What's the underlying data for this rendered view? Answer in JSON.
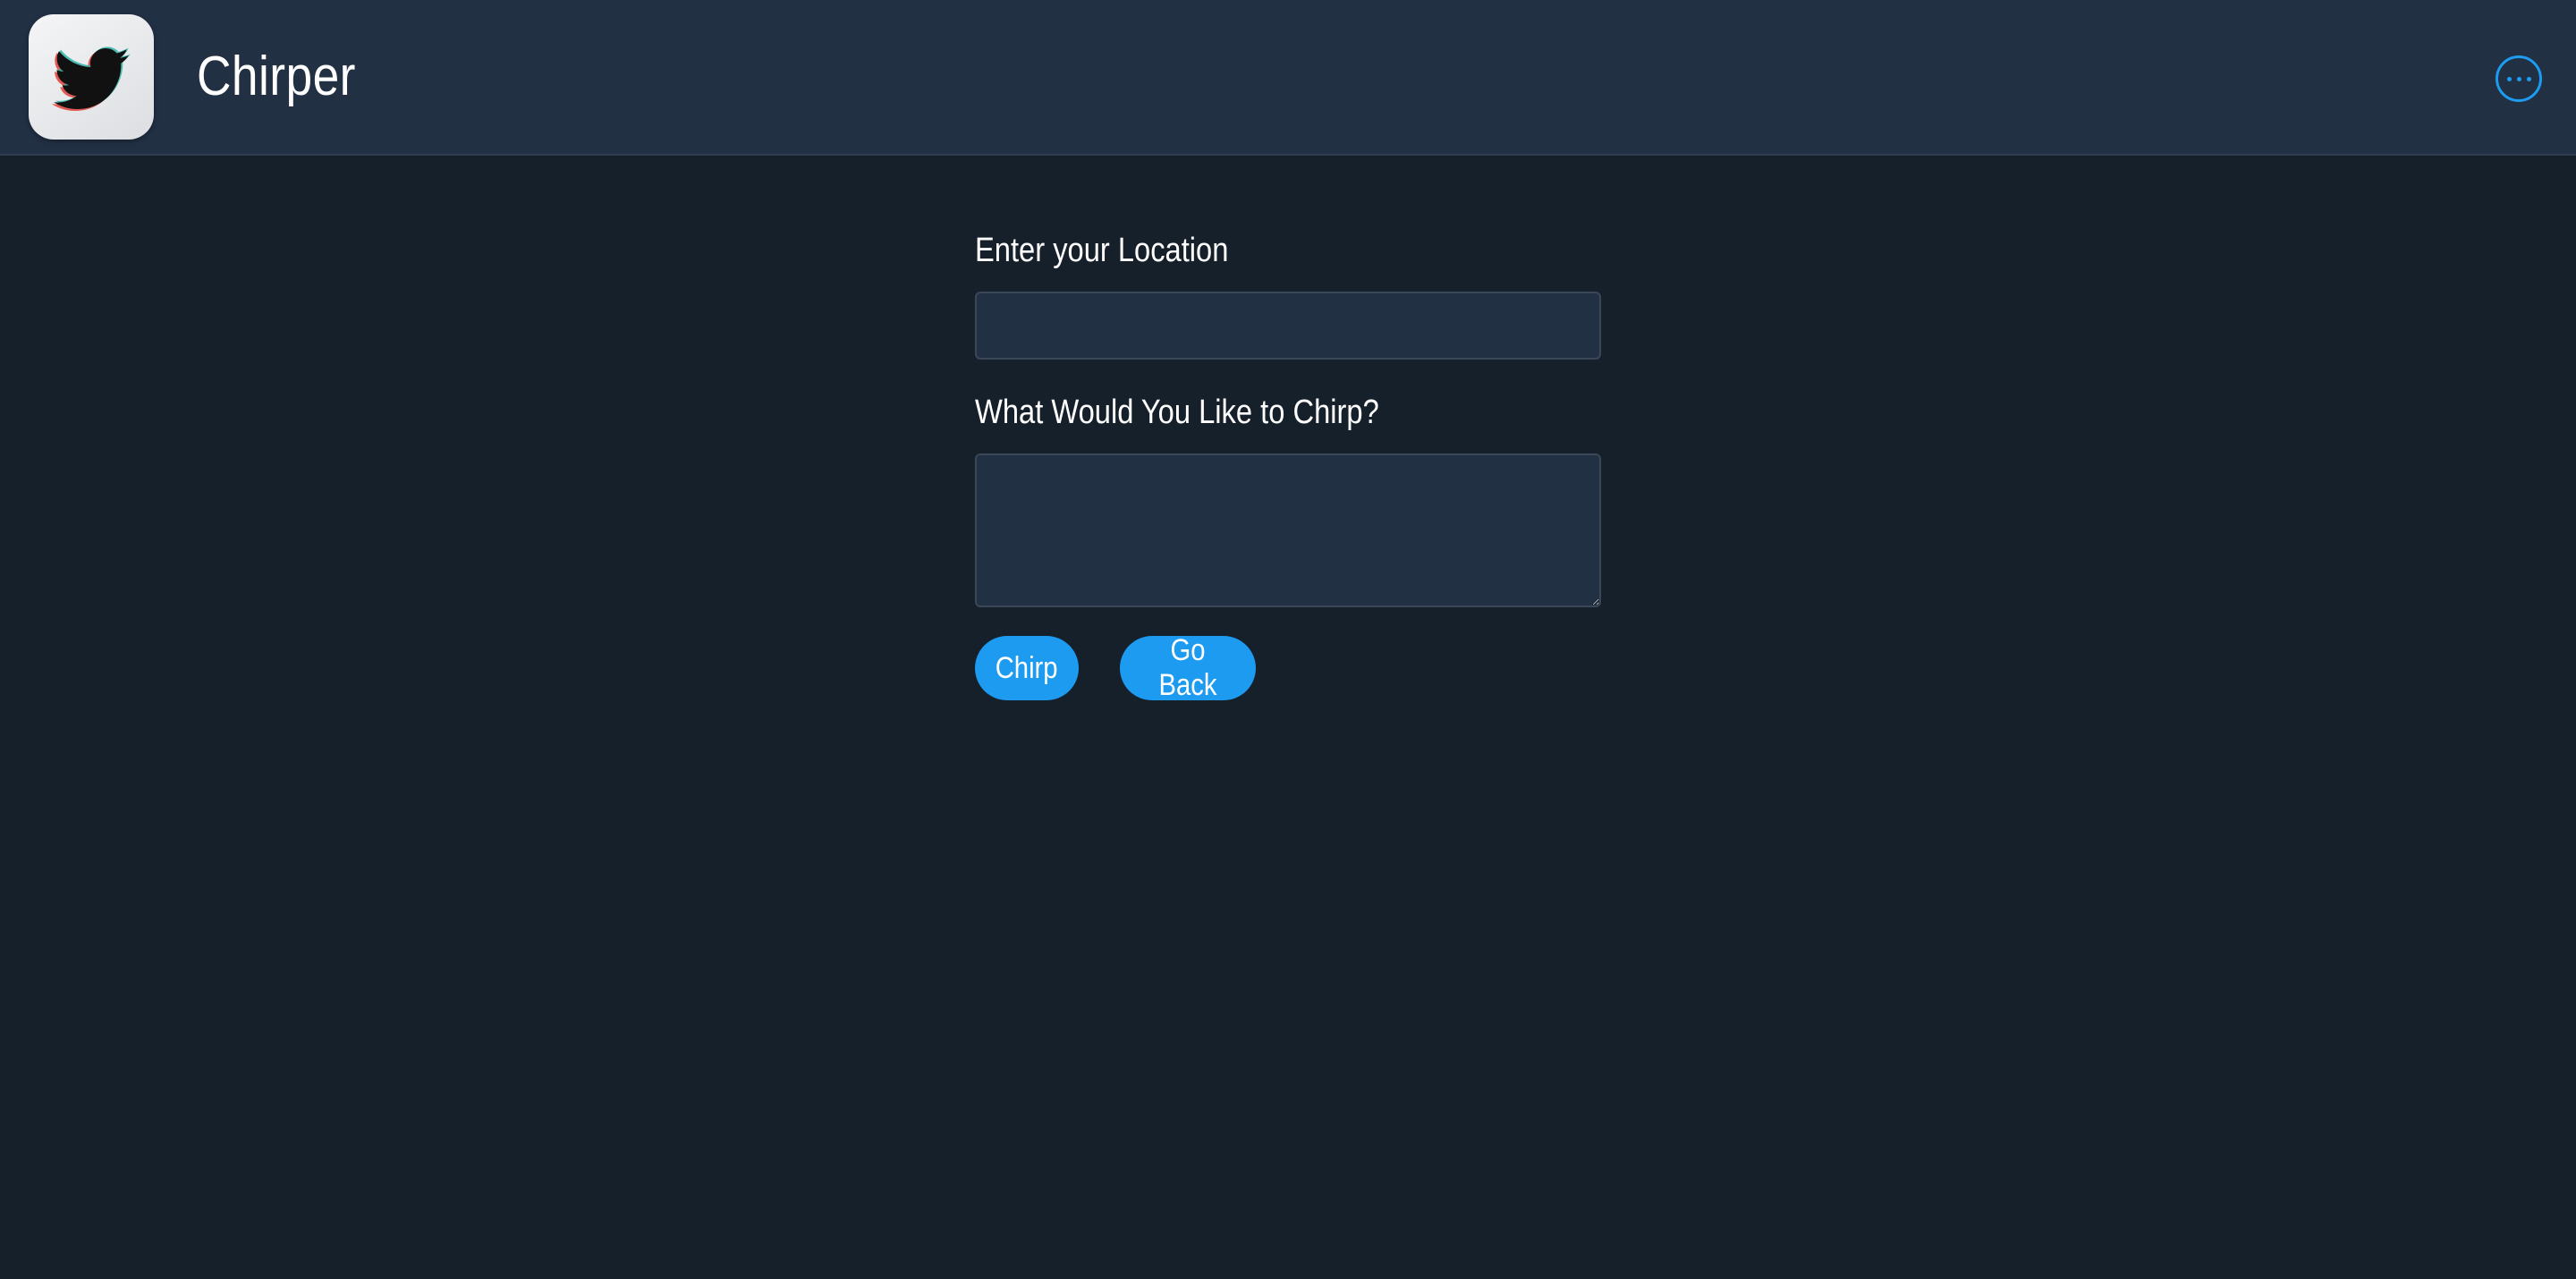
{
  "header": {
    "app_title": "Chirper",
    "logo_icon": "bird-icon",
    "menu_icon": "more-horizontal-icon"
  },
  "form": {
    "location_label": "Enter your Location",
    "location_value": "",
    "chirp_label": "What Would You Like to Chirp?",
    "chirp_value": ""
  },
  "buttons": {
    "chirp_label": "Chirp",
    "back_label": "Go Back"
  },
  "colors": {
    "background": "#15202b",
    "header_background": "#223044",
    "accent": "#1d9bf0",
    "input_background": "#223044"
  }
}
